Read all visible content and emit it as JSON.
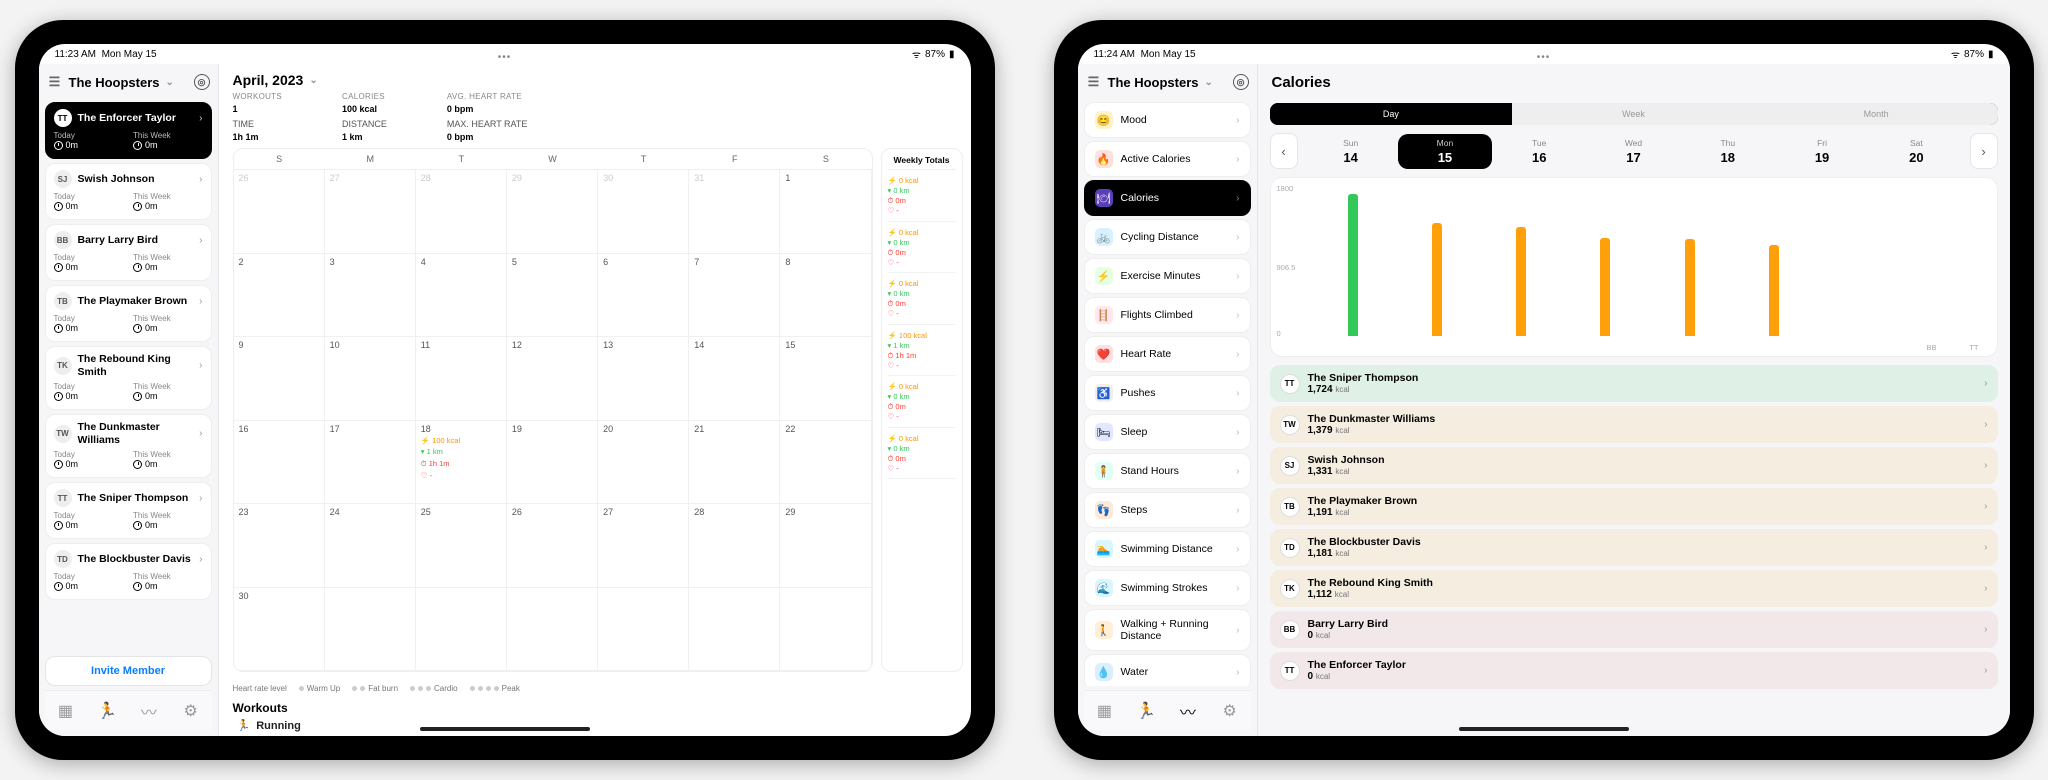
{
  "left": {
    "status": {
      "time": "11:23 AM",
      "date": "Mon May 15",
      "battery": "87%"
    },
    "team_name": "The Hoopsters",
    "athletes": [
      {
        "initials": "TT",
        "name": "The Enforcer Taylor",
        "today": "0m",
        "week": "0m",
        "active": true
      },
      {
        "initials": "SJ",
        "name": "Swish Johnson",
        "today": "0m",
        "week": "0m"
      },
      {
        "initials": "BB",
        "name": "Barry Larry Bird",
        "today": "0m",
        "week": "0m"
      },
      {
        "initials": "TB",
        "name": "The Playmaker Brown",
        "today": "0m",
        "week": "0m"
      },
      {
        "initials": "TK",
        "name": "The Rebound King Smith",
        "today": "0m",
        "week": "0m"
      },
      {
        "initials": "TW",
        "name": "The Dunkmaster Williams",
        "today": "0m",
        "week": "0m"
      },
      {
        "initials": "TT",
        "name": "The Sniper Thompson",
        "today": "0m",
        "week": "0m"
      },
      {
        "initials": "TD",
        "name": "The Blockbuster Davis",
        "today": "0m",
        "week": "0m"
      }
    ],
    "stat_labels": {
      "today": "Today",
      "week": "This Week"
    },
    "invite": "Invite Member",
    "month_title": "April, 2023",
    "summary": {
      "workouts_label": "WORKOUTS",
      "workouts": "1",
      "time_label": "TIME",
      "time": "1h 1m",
      "calories_label": "CALORIES",
      "calories": "100 kcal",
      "distance_label": "DISTANCE",
      "distance": "1 km",
      "avg_hr_label": "AVG. HEART RATE",
      "avg_hr": "0 bpm",
      "max_hr_label": "MAX. HEART RATE",
      "max_hr": "0 bpm"
    },
    "day_headers": [
      "S",
      "M",
      "T",
      "W",
      "T",
      "F",
      "S"
    ],
    "calendar_cells": [
      {
        "n": "26",
        "dim": true
      },
      {
        "n": "27",
        "dim": true
      },
      {
        "n": "28",
        "dim": true
      },
      {
        "n": "29",
        "dim": true
      },
      {
        "n": "30",
        "dim": true
      },
      {
        "n": "31",
        "dim": true
      },
      {
        "n": "1"
      },
      {
        "n": "2"
      },
      {
        "n": "3"
      },
      {
        "n": "4"
      },
      {
        "n": "5"
      },
      {
        "n": "6"
      },
      {
        "n": "7"
      },
      {
        "n": "8"
      },
      {
        "n": "9"
      },
      {
        "n": "10"
      },
      {
        "n": "11"
      },
      {
        "n": "12"
      },
      {
        "n": "13"
      },
      {
        "n": "14"
      },
      {
        "n": "15"
      },
      {
        "n": "16"
      },
      {
        "n": "17"
      },
      {
        "n": "18",
        "evt": [
          "100 kcal",
          "1 km",
          "1h 1m",
          "-"
        ]
      },
      {
        "n": "19"
      },
      {
        "n": "20"
      },
      {
        "n": "21"
      },
      {
        "n": "22"
      },
      {
        "n": "23"
      },
      {
        "n": "24"
      },
      {
        "n": "25"
      },
      {
        "n": "26"
      },
      {
        "n": "27"
      },
      {
        "n": "28"
      },
      {
        "n": "29"
      },
      {
        "n": "30"
      },
      {
        "n": "",
        "dim": true
      },
      {
        "n": "",
        "dim": true
      },
      {
        "n": "",
        "dim": true
      },
      {
        "n": "",
        "dim": true
      },
      {
        "n": "",
        "dim": true
      },
      {
        "n": "",
        "dim": true
      }
    ],
    "weekly_title": "Weekly Totals",
    "weekly": [
      {
        "cal": "0 kcal",
        "dist": "0 km",
        "time": "0m",
        "hr": "-"
      },
      {
        "cal": "0 kcal",
        "dist": "0 km",
        "time": "0m",
        "hr": "-"
      },
      {
        "cal": "0 kcal",
        "dist": "0 km",
        "time": "0m",
        "hr": "-"
      },
      {
        "cal": "100 kcal",
        "dist": "1 km",
        "time": "1h 1m",
        "hr": "-"
      },
      {
        "cal": "0 kcal",
        "dist": "0 km",
        "time": "0m",
        "hr": "-"
      },
      {
        "cal": "0 kcal",
        "dist": "0 km",
        "time": "0m",
        "hr": "-"
      }
    ],
    "hr_legend_title": "Heart rate level",
    "hr_zones": [
      "Warm Up",
      "Fat burn",
      "Cardio",
      "Peak"
    ],
    "workouts_heading": "Workouts",
    "workout_row": "Running"
  },
  "right": {
    "status": {
      "time": "11:24 AM",
      "date": "Mon May 15",
      "battery": "87%"
    },
    "team_name": "The Hoopsters",
    "metrics": [
      {
        "icon": "😊",
        "label": "Mood",
        "bg": "#fff3cc"
      },
      {
        "icon": "🔥",
        "label": "Active Calories",
        "bg": "#ffe1dc"
      },
      {
        "icon": "🍽",
        "label": "Calories",
        "bg": "#5b3fba",
        "active": true
      },
      {
        "icon": "🚲",
        "label": "Cycling Distance",
        "bg": "#d9f1ff"
      },
      {
        "icon": "⚡",
        "label": "Exercise Minutes",
        "bg": "#e5ffe0"
      },
      {
        "icon": "🪜",
        "label": "Flights Climbed",
        "bg": "#ffe6f0"
      },
      {
        "icon": "❤️",
        "label": "Heart Rate",
        "bg": "#ffe0e0"
      },
      {
        "icon": "♿",
        "label": "Pushes",
        "bg": "#eee"
      },
      {
        "icon": "🛏",
        "label": "Sleep",
        "bg": "#e0e7ff"
      },
      {
        "icon": "🧍",
        "label": "Stand Hours",
        "bg": "#e0fff5"
      },
      {
        "icon": "👣",
        "label": "Steps",
        "bg": "#ffe8d6"
      },
      {
        "icon": "🏊",
        "label": "Swimming Distance",
        "bg": "#d9f5ff"
      },
      {
        "icon": "🌊",
        "label": "Swimming Strokes",
        "bg": "#d9f5ff"
      },
      {
        "icon": "🚶",
        "label": "Walking + Running Distance",
        "bg": "#ffefd6"
      },
      {
        "icon": "💧",
        "label": "Water",
        "bg": "#d9efff"
      }
    ],
    "page_title": "Calories",
    "segments": [
      "Day",
      "Week",
      "Month"
    ],
    "segment_active": 0,
    "days": [
      {
        "dow": "Sun",
        "num": "14"
      },
      {
        "dow": "Mon",
        "num": "15",
        "active": true
      },
      {
        "dow": "Tue",
        "num": "16"
      },
      {
        "dow": "Wed",
        "num": "17"
      },
      {
        "dow": "Thu",
        "num": "18"
      },
      {
        "dow": "Fri",
        "num": "19"
      },
      {
        "dow": "Sat",
        "num": "20"
      }
    ],
    "rank": [
      {
        "initials": "TT",
        "name": "The Sniper Thompson",
        "value": "1,724",
        "unit": "kcal",
        "bg": "#dff0e6"
      },
      {
        "initials": "TW",
        "name": "The Dunkmaster Williams",
        "value": "1,379",
        "unit": "kcal",
        "bg": "#f5ede0"
      },
      {
        "initials": "SJ",
        "name": "Swish Johnson",
        "value": "1,331",
        "unit": "kcal",
        "bg": "#f5ede0"
      },
      {
        "initials": "TB",
        "name": "The Playmaker Brown",
        "value": "1,191",
        "unit": "kcal",
        "bg": "#f5ede0"
      },
      {
        "initials": "TD",
        "name": "The Blockbuster Davis",
        "value": "1,181",
        "unit": "kcal",
        "bg": "#f5ede0"
      },
      {
        "initials": "TK",
        "name": "The Rebound King Smith",
        "value": "1,112",
        "unit": "kcal",
        "bg": "#f5ede0"
      },
      {
        "initials": "BB",
        "name": "Barry Larry Bird",
        "value": "0",
        "unit": "kcal",
        "bg": "#f2e8ea"
      },
      {
        "initials": "TT",
        "name": "The Enforcer Taylor",
        "value": "0",
        "unit": "kcal",
        "bg": "#f2e8ea"
      }
    ]
  },
  "chart_data": {
    "type": "bar",
    "title": "Calories",
    "ylabel": "kcal",
    "ylim": [
      0,
      1800
    ],
    "yticks": [
      0,
      906.5,
      1800
    ],
    "categories": [
      "TT",
      "TW",
      "SJ",
      "TB",
      "TD",
      "TK",
      "BB",
      "TT"
    ],
    "series": [
      {
        "name": "Calories",
        "values": [
          1724,
          1379,
          1331,
          1191,
          1181,
          1112,
          0,
          0
        ],
        "colors": [
          "#34c759",
          "#ff9f0a",
          "#ff9f0a",
          "#ff9f0a",
          "#ff9f0a",
          "#ff9f0a",
          "#ff9f0a",
          "#ff9f0a"
        ]
      }
    ],
    "xticklabels_visible": [
      "",
      "",
      "",
      "",
      "",
      "",
      "BB",
      "TT"
    ]
  }
}
